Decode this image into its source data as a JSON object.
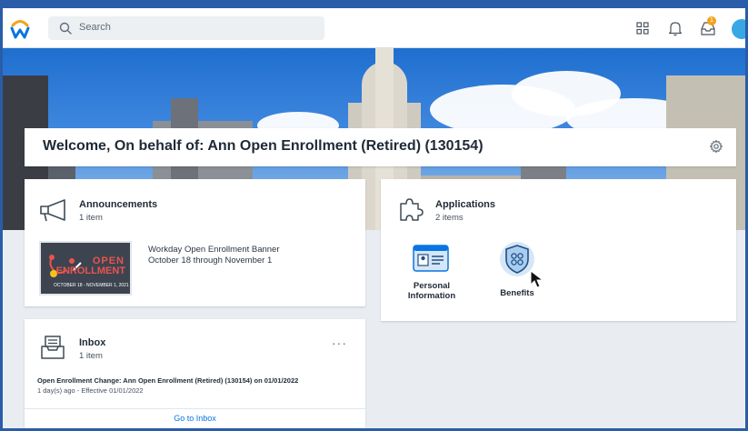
{
  "search": {
    "placeholder": "Search"
  },
  "welcome": {
    "title": "Welcome, On behalf of: Ann Open Enrollment (Retired) (130154)"
  },
  "notifications": {
    "badge": "1"
  },
  "announcements": {
    "title": "Announcements",
    "count": "1 item",
    "item_title": "Workday Open Enrollment Banner",
    "item_date": "October 18 through November 1",
    "banner_text_1": "OPEN",
    "banner_text_2": "ENROLLMENT",
    "banner_text_3": "OCTOBER 18 - NOVEMBER 1, 2021"
  },
  "applications": {
    "title": "Applications",
    "count": "2 items",
    "items": [
      {
        "label": "Personal Information"
      },
      {
        "label": "Benefits"
      }
    ]
  },
  "inbox": {
    "title": "Inbox",
    "count": "1 item",
    "message": "Open Enrollment Change: Ann Open Enrollment (Retired) (130154) on 01/01/2022",
    "meta": "1 day(s) ago - Effective 01/01/2022",
    "link": "Go to Inbox",
    "more": "···"
  },
  "colors": {
    "brand_blue": "#0875e1",
    "frame": "#2a5ca8",
    "badge": "#f5a21b"
  }
}
